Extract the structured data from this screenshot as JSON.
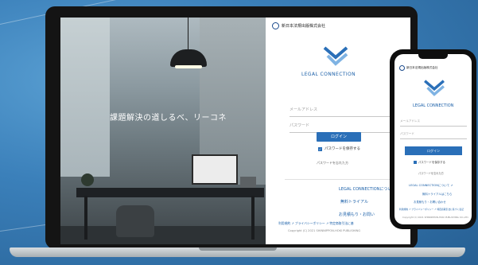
{
  "colors": {
    "accent": "#2a6fb8",
    "brand": "#1a5fa8",
    "background": "#3b80ba"
  },
  "desktop": {
    "company": "新日本法規出版株式会社",
    "hero_text": "課題解決の道しるべ、リーコネ",
    "brand": "LEGAL CONNECTION",
    "email_placeholder": "メールアドレス",
    "password_placeholder": "パスワード",
    "login_label": "ログイン",
    "remember_label": "パスワードを保存する",
    "forgot_label": "パスワードを忘れた方",
    "info_title": "LEGAL CONNECTIONについて",
    "trial_label": "無料トライアル",
    "estimate_label": "お見積もり・お問い",
    "links": "利用規約 ↗  プライバシーポリシー ↗  特定商取引法に基",
    "copyright": "Copyright (C) 2021 SHINNIPPON-HOKI PUBLISHING"
  },
  "mobile": {
    "company": "新日本法規出版株式会社",
    "brand": "LEGAL CONNECTION",
    "email_placeholder": "メールアドレス",
    "password_placeholder": "パスワード",
    "login_label": "ログイン",
    "remember_label": "パスワードを保存する",
    "forgot_label": "パスワードを忘れた方",
    "info_title": "LEGAL CONNECTIONについて ↗",
    "trial_label": "無料トライアルはこちら",
    "estimate_label": "お見積もり・お問い合わせ",
    "links": "利用規約 ↗  プライバシーポリシー ↗  特定商取引法に基づく表記",
    "copyright": "Copyright (C) 2021 SHINNIPPON-HOKI PUBLISHING CO.,LTD."
  }
}
